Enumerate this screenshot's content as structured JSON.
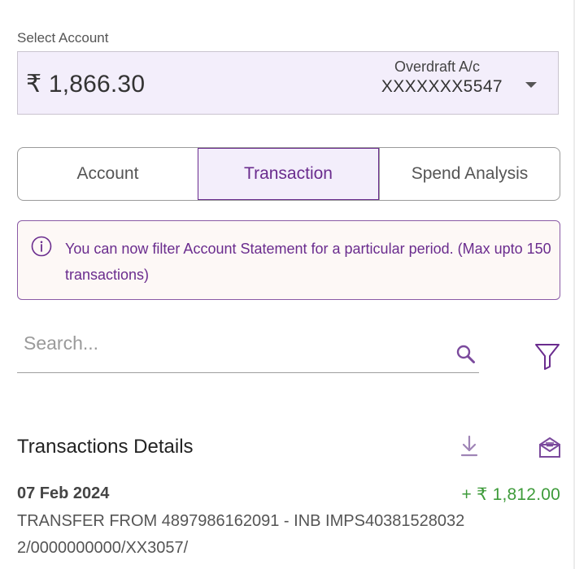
{
  "account_select": {
    "label": "Select Account",
    "balance": "₹ 1,866.30",
    "account_type": "Overdraft A/c",
    "account_number": "XXXXXXX5547"
  },
  "tabs": [
    {
      "label": "Account",
      "active": false
    },
    {
      "label": "Transaction",
      "active": true
    },
    {
      "label": "Spend Analysis",
      "active": false
    }
  ],
  "info_banner": {
    "icon": "info-icon",
    "text": "You can now filter Account Statement for a particular period. (Max upto 150 transactions)"
  },
  "search": {
    "placeholder": "Search...",
    "value": "",
    "icon": "search-icon"
  },
  "filter": {
    "icon": "filter-icon"
  },
  "transactions_section": {
    "title": "Transactions Details",
    "download_icon": "download-icon",
    "email_icon": "email-icon"
  },
  "transactions": [
    {
      "date": "07 Feb 2024",
      "amount": "+ ₹  1,812.00",
      "description": "TRANSFER FROM 4897986162091 - INB IMPS403815280322/0000000000/XX3057/"
    }
  ],
  "colors": {
    "accent": "#6a2c8e",
    "selected_bg": "#f3eefb",
    "credit": "#3e9b3a",
    "banner_bg": "#fdf8f6"
  }
}
